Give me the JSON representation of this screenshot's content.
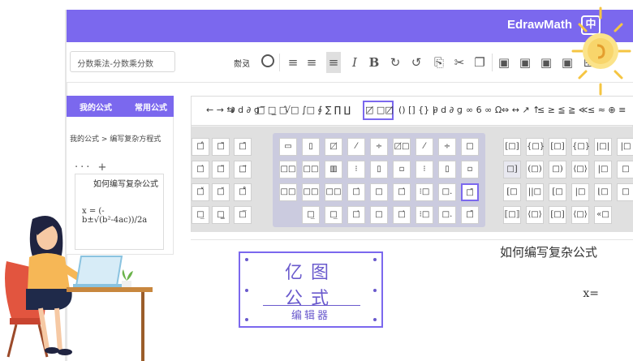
{
  "app": {
    "name": "EdrawMath",
    "logo_glyph": "中"
  },
  "toolbar": {
    "search_text": "分数乘法-分数乘分数",
    "feedback_label": "反馈"
  },
  "sidebar": {
    "tabs": [
      "常用公式",
      "我的公式"
    ],
    "breadcrumb": "我的公式 > 编写复杂方程式",
    "more": "··· +",
    "card_title": "如何编写复杂公式",
    "card_formula": "x = (-b±√(b²-4ac))/2a"
  },
  "symbols": {
    "header_items": [
      "≤ ≈ ⊕ ≡",
      "≤ ≥ ≦ ≧ ≪",
      "⇔ ↔ ↗ ↑",
      "∞ 6 ∞ Ω",
      "∂ d ∂ ɡ",
      "() [] {} |",
      "□̸ □□̸",
      "∑ ∏ ∐",
      "√□ ∫□ ∮",
      "□̅ □̲ □̂",
      "← → ⇆",
      "□ □̸"
    ],
    "active_index": 6
  },
  "editor": {
    "title": "如何编写复杂公式",
    "placeholder_mark": "x=",
    "logo": {
      "line1": "亿图",
      "line2": "公式",
      "amp": "&",
      "line3": "编辑器"
    }
  }
}
